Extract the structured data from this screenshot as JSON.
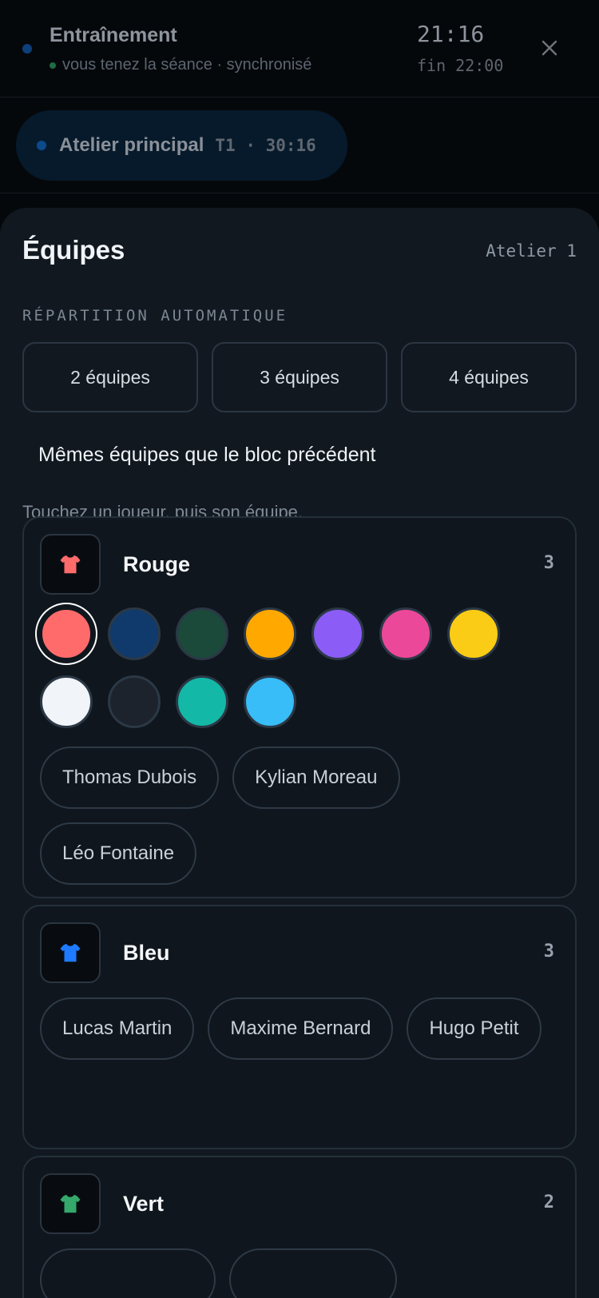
{
  "header": {
    "title": "Entraînement",
    "status": "vous tenez la séance · synchronisé",
    "time": "21:16",
    "end": "fin 22:00",
    "close_icon": "close-icon"
  },
  "session": {
    "name": "Atelier principal",
    "meta": "T1 · 30:16"
  },
  "sheet": {
    "title": "Équipes",
    "tag": "Atelier 1",
    "section_label": "RÉPARTITION AUTOMATIQUE",
    "splits": [
      "2 équipes",
      "3 équipes",
      "4 équipes"
    ],
    "same_teams": "Mêmes équipes que le bloc précédent",
    "hint": "Touchez un joueur, puis son équipe."
  },
  "palette": [
    "#ff6b6b",
    "#0f3a6b",
    "#1c4a3a",
    "#ffa800",
    "#8b5cf6",
    "#ec4899",
    "#facc15",
    "#f1f5f9",
    "#1c232d",
    "#14b8a6",
    "#38bdf8"
  ],
  "teams": [
    {
      "name": "Rouge",
      "count": "3",
      "color": "#ff6b6b",
      "players": [
        "Thomas Dubois",
        "Kylian Moreau",
        "Léo Fontaine"
      ]
    },
    {
      "name": "Bleu",
      "count": "3",
      "color": "#1e7bff",
      "players": [
        "Lucas Martin",
        "Maxime Bernard",
        "Hugo Petit"
      ]
    },
    {
      "name": "Vert",
      "count": "2",
      "color": "#35a86b",
      "players": []
    }
  ]
}
